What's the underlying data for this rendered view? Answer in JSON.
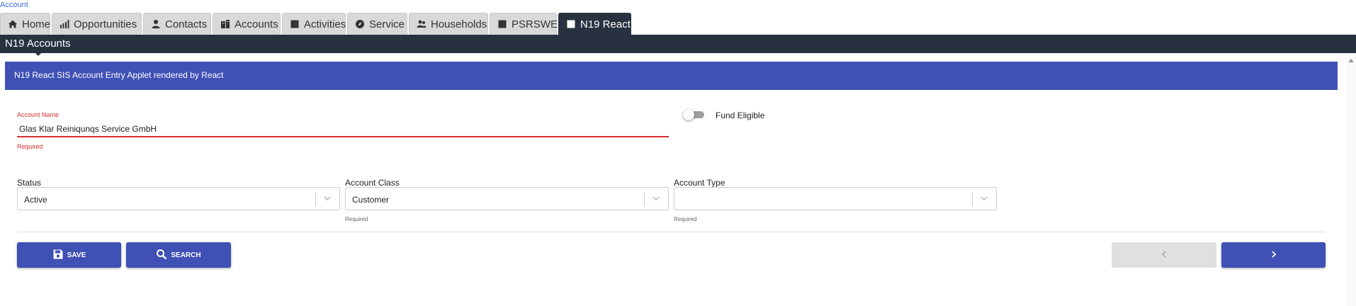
{
  "breadcrumb": "Account",
  "tabs": [
    {
      "label": "Home",
      "icon": "home-icon"
    },
    {
      "label": "Opportunities",
      "icon": "chart-icon"
    },
    {
      "label": "Contacts",
      "icon": "person-icon"
    },
    {
      "label": "Accounts",
      "icon": "building-icon"
    },
    {
      "label": "Activities",
      "icon": "square-icon"
    },
    {
      "label": "Service",
      "icon": "compass-icon"
    },
    {
      "label": "Households",
      "icon": "people-icon"
    },
    {
      "label": "PSRSWE",
      "icon": "square-icon"
    },
    {
      "label": "N19 React",
      "icon": "square-icon",
      "active": true
    }
  ],
  "subview": {
    "title": "N19 Accounts"
  },
  "applet": {
    "title": "N19 React SIS Account Entry Applet rendered by React"
  },
  "form": {
    "account_name": {
      "label": "Account Name",
      "value": "Glas Klar Reiniqunqs Service GmbH",
      "helper": "Required"
    },
    "fund_eligible": {
      "label": "Fund Eligible",
      "checked": false
    },
    "status": {
      "label": "Status",
      "value": "Active"
    },
    "account_class": {
      "label": "Account Class",
      "value": "Customer",
      "helper": "Required"
    },
    "account_type": {
      "label": "Account Type",
      "value": "",
      "helper": "Required"
    }
  },
  "buttons": {
    "save": "SAVE",
    "search": "SEARCH"
  },
  "colors": {
    "primary": "#3f51b5",
    "header": "#283140",
    "error": "#d32f2f",
    "link": "#3a6fcf"
  }
}
